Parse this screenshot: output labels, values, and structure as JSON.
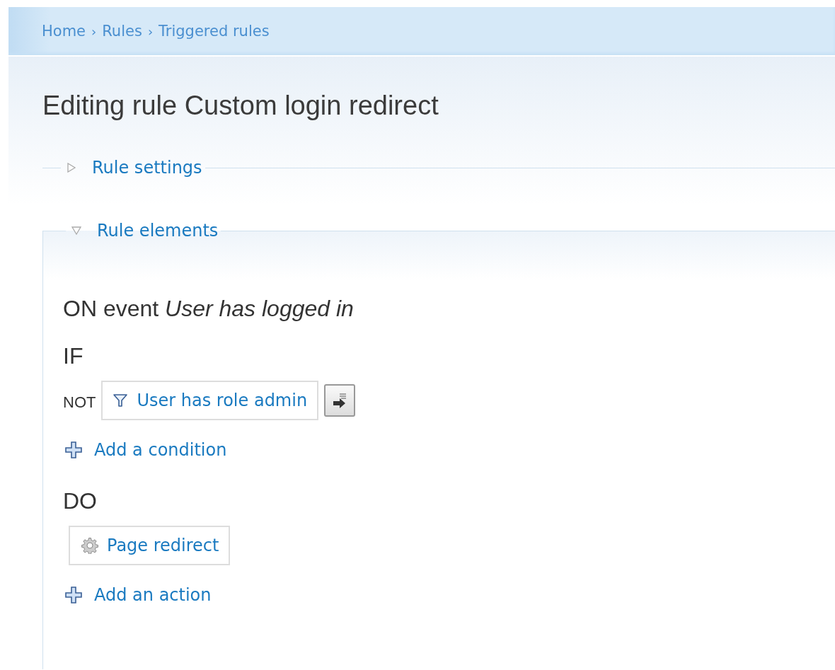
{
  "breadcrumb": [
    {
      "label": "Home",
      "separator": "›"
    },
    {
      "label": "Rules",
      "separator": "›"
    },
    {
      "label": "Triggered rules"
    }
  ],
  "title": "Editing rule Custom login redirect",
  "fieldsets": [
    {
      "legend": "Rule settings",
      "expanded": false
    },
    {
      "legend": "Rule elements",
      "expanded": true,
      "event": {
        "prefix": "ON event",
        "name": "User has logged in"
      },
      "conditions_heading": "IF",
      "conditions": [
        {
          "prefix": "NOT",
          "label": "User has role admin",
          "kind": "condition"
        }
      ],
      "add_condition": "Add a condition",
      "actions_heading": "DO",
      "actions": [
        {
          "label": "Page redirect",
          "kind": "action"
        }
      ],
      "add_action": "Add an action"
    }
  ]
}
